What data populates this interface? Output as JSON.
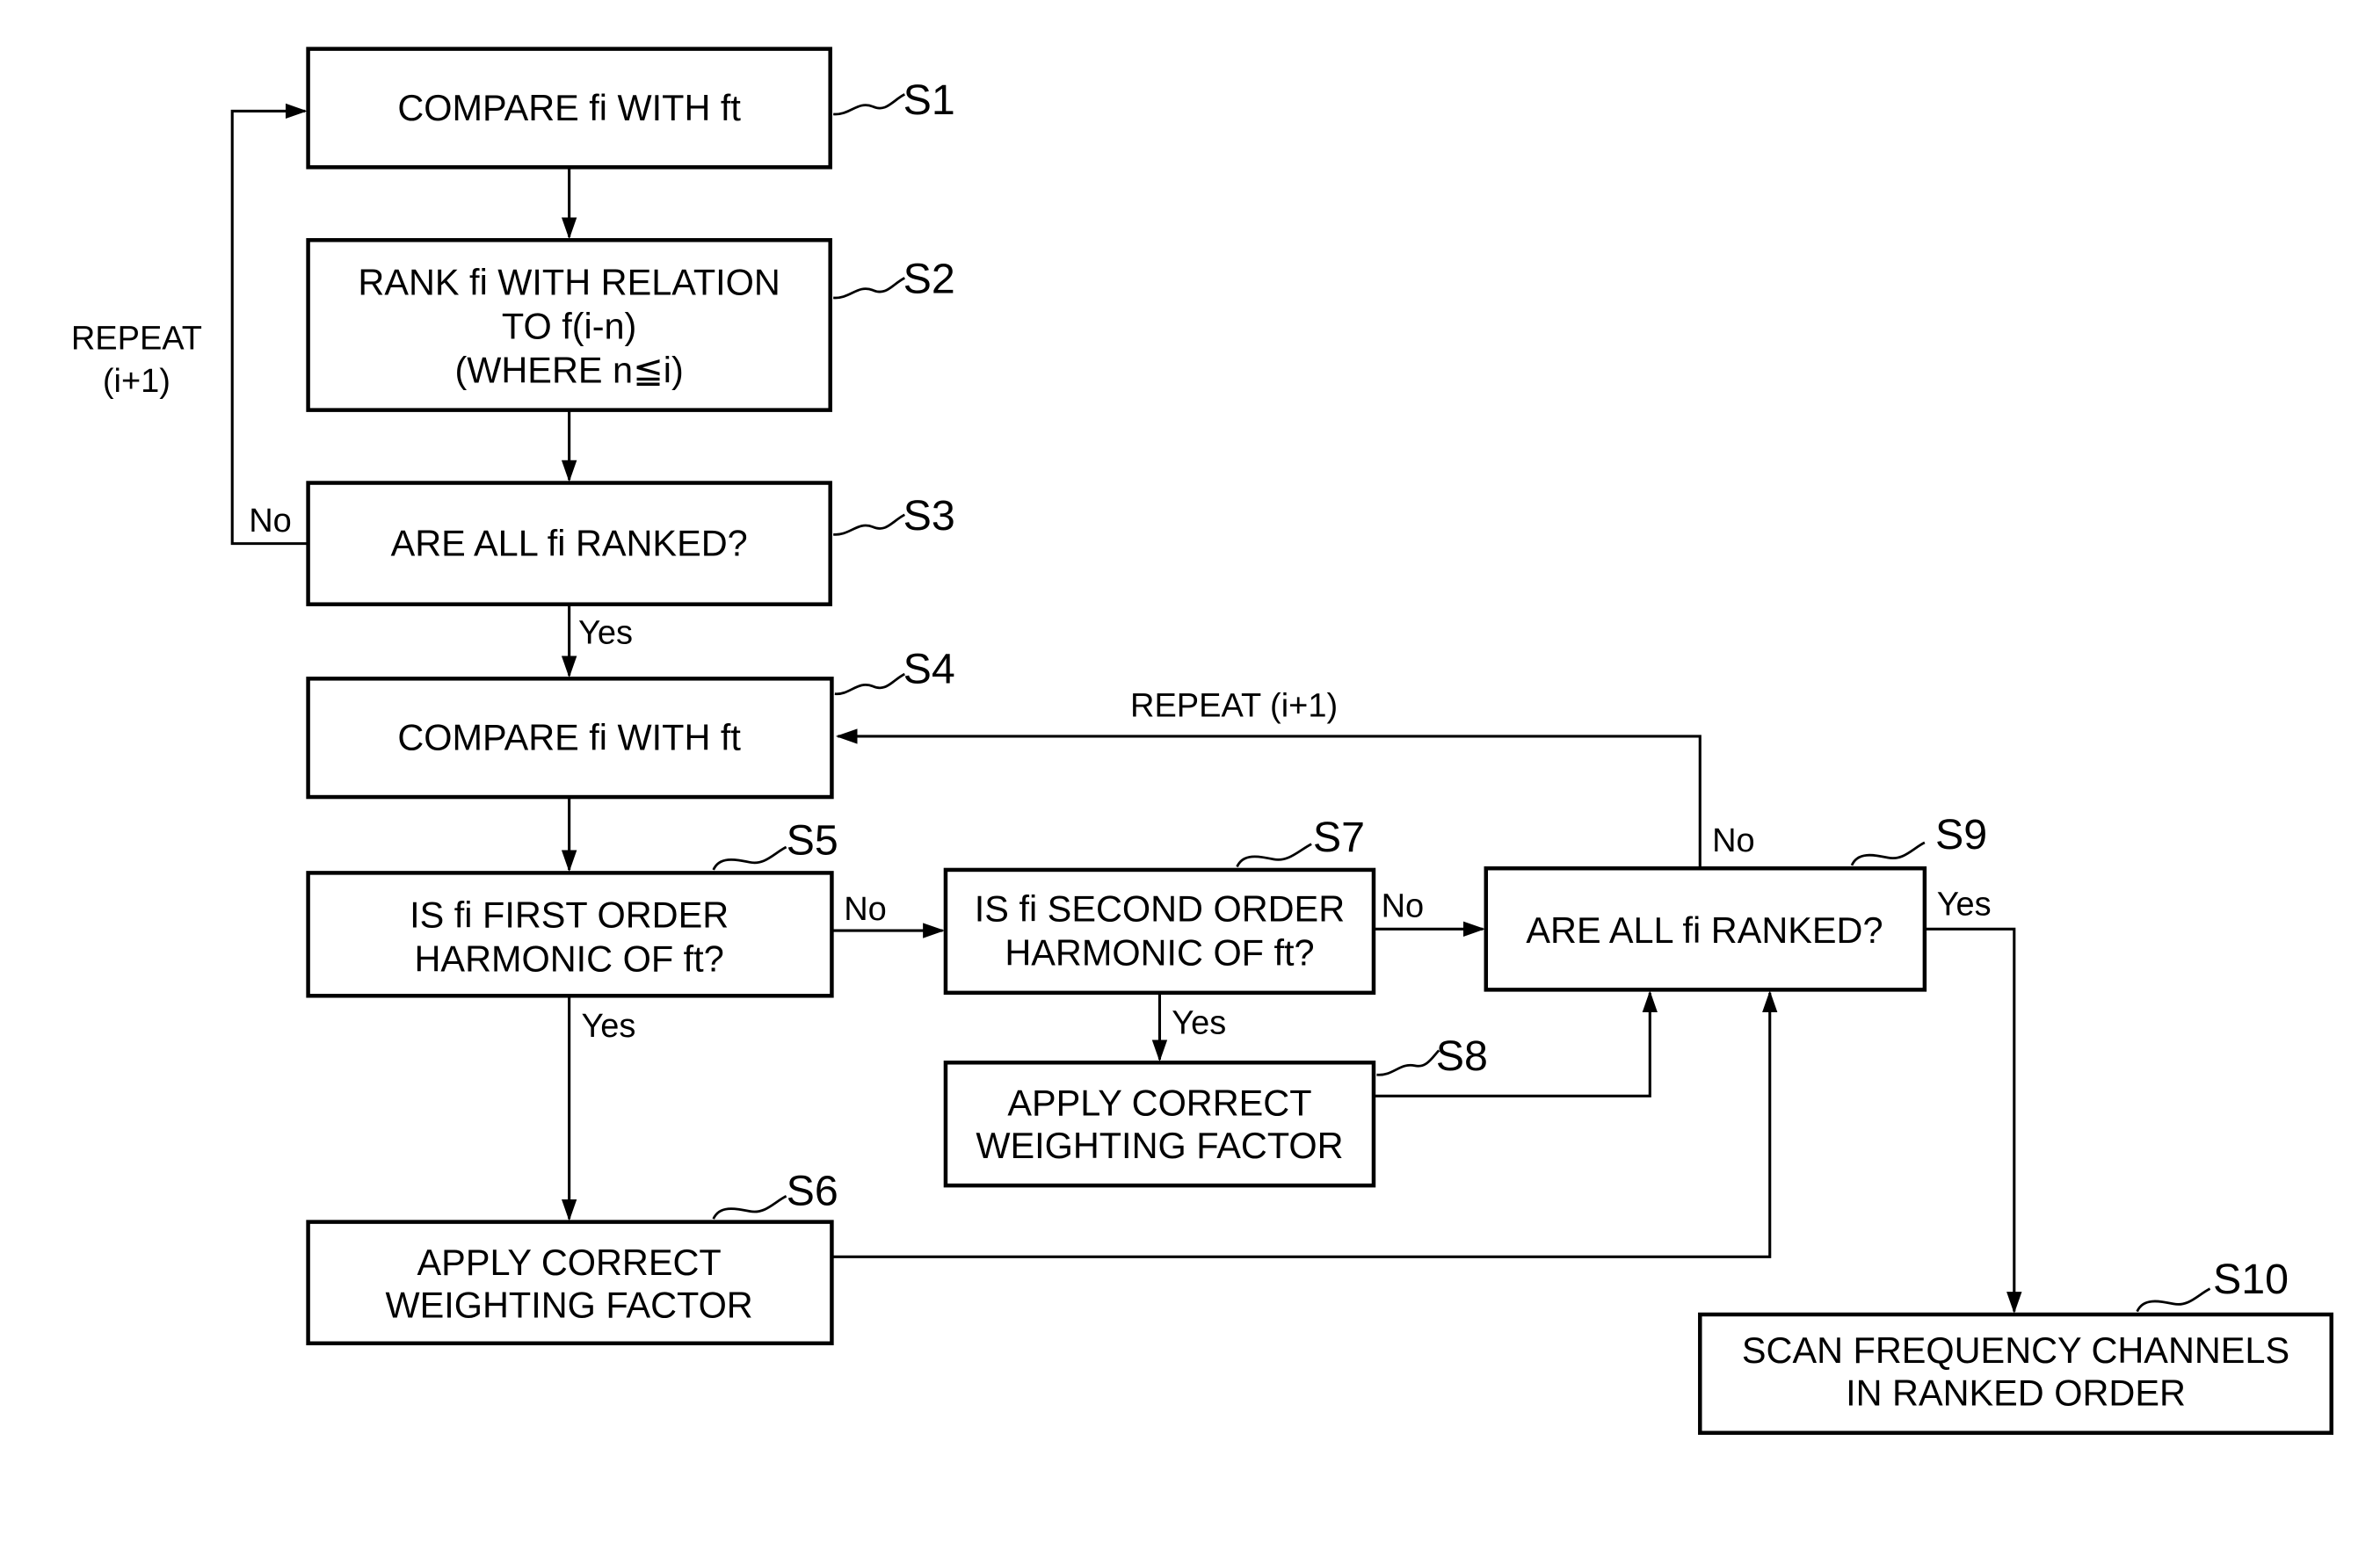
{
  "diagram": {
    "type": "flowchart",
    "steps": {
      "s1": {
        "id": "S1",
        "lines": [
          "COMPARE fi WITH ft"
        ]
      },
      "s2": {
        "id": "S2",
        "lines": [
          "RANK fi WITH RELATION",
          "TO f(i-n)",
          "(WHERE n≦i)"
        ]
      },
      "s3": {
        "id": "S3",
        "lines": [
          "ARE ALL fi RANKED?"
        ]
      },
      "s4": {
        "id": "S4",
        "lines": [
          "COMPARE fi WITH ft"
        ]
      },
      "s5": {
        "id": "S5",
        "lines": [
          "IS fi FIRST ORDER",
          "HARMONIC OF ft?"
        ]
      },
      "s6": {
        "id": "S6",
        "lines": [
          "APPLY CORRECT",
          "WEIGHTING FACTOR"
        ]
      },
      "s7": {
        "id": "S7",
        "lines": [
          "IS fi SECOND ORDER",
          "HARMONIC OF ft?"
        ]
      },
      "s8": {
        "id": "S8",
        "lines": [
          "APPLY CORRECT",
          "WEIGHTING FACTOR"
        ]
      },
      "s9": {
        "id": "S9",
        "lines": [
          "ARE ALL fi RANKED?"
        ]
      },
      "s10": {
        "id": "S10",
        "lines": [
          "SCAN FREQUENCY CHANNELS",
          "IN RANKED ORDER"
        ]
      }
    },
    "labels": {
      "repeat_left_1": "REPEAT",
      "repeat_left_2": "(i+1)",
      "repeat_right": "REPEAT (i+1)",
      "s3_no": "No",
      "s3_yes": "Yes",
      "s5_no": "No",
      "s5_yes": "Yes",
      "s7_no": "No",
      "s7_yes": "Yes",
      "s9_no": "No",
      "s9_yes": "Yes"
    },
    "edges": [
      {
        "from": "S1",
        "to": "S2"
      },
      {
        "from": "S2",
        "to": "S3"
      },
      {
        "from": "S3",
        "to": "S1",
        "label": "No",
        "note": "REPEAT (i+1)"
      },
      {
        "from": "S3",
        "to": "S4",
        "label": "Yes"
      },
      {
        "from": "S4",
        "to": "S5"
      },
      {
        "from": "S5",
        "to": "S7",
        "label": "No"
      },
      {
        "from": "S5",
        "to": "S6",
        "label": "Yes"
      },
      {
        "from": "S7",
        "to": "S9",
        "label": "No"
      },
      {
        "from": "S7",
        "to": "S8",
        "label": "Yes"
      },
      {
        "from": "S8",
        "to": "S9"
      },
      {
        "from": "S6",
        "to": "S9"
      },
      {
        "from": "S9",
        "to": "S4",
        "label": "No",
        "note": "REPEAT (i+1)"
      },
      {
        "from": "S9",
        "to": "S10",
        "label": "Yes"
      }
    ]
  }
}
